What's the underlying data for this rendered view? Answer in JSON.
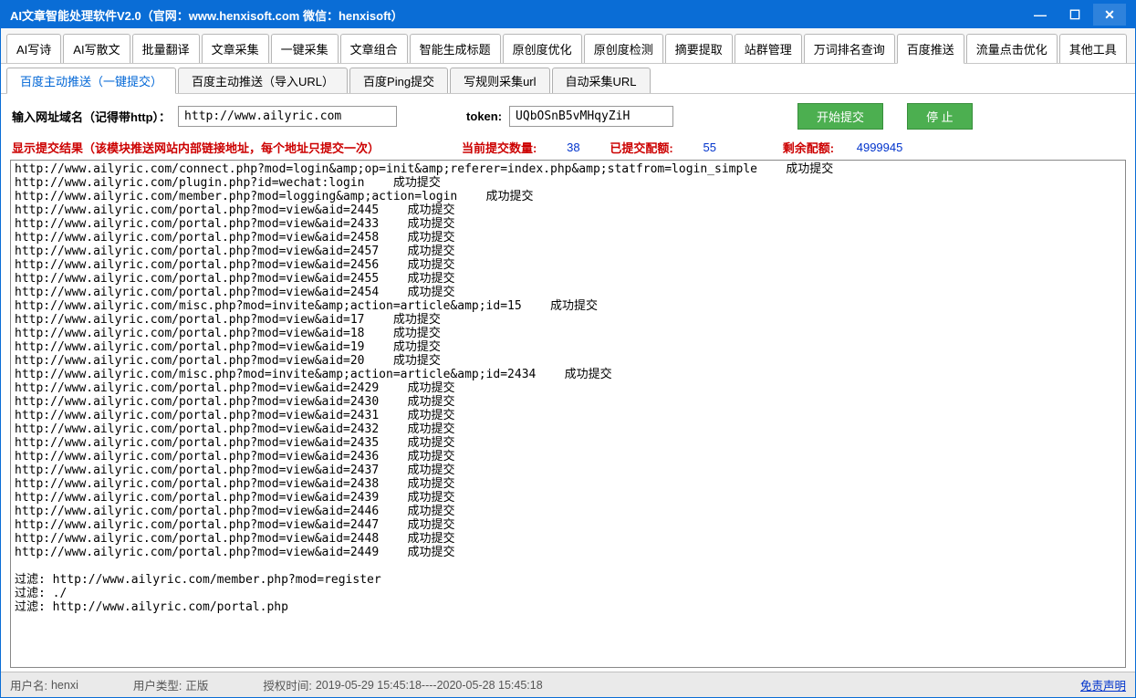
{
  "titlebar": "AI文章智能处理软件V2.0（官网：www.henxisoft.com  微信：henxisoft）",
  "main_tabs": [
    "AI写诗",
    "AI写散文",
    "批量翻译",
    "文章采集",
    "一键采集",
    "文章组合",
    "智能生成标题",
    "原创度优化",
    "原创度检测",
    "摘要提取",
    "站群管理",
    "万词排名查询",
    "百度推送",
    "流量点击优化",
    "其他工具"
  ],
  "main_tab_active": 12,
  "sub_tabs": [
    "百度主动推送（一键提交）",
    "百度主动推送（导入URL）",
    "百度Ping提交",
    "写规则采集url",
    "自动采集URL"
  ],
  "sub_tab_active": 0,
  "input": {
    "domain_label": "输入网址域名（记得带http）：",
    "domain_value": "http://www.ailyric.com",
    "token_label": "token:",
    "token_value": "UQbOSnB5vMHqyZiH",
    "start_btn": "开始提交",
    "stop_btn": "停 止"
  },
  "stats": {
    "result_label": "显示提交结果（该模块推送网站内部链接地址，每个地址只提交一次）",
    "current_label": "当前提交数量:",
    "current_value": "38",
    "submitted_label": "已提交配额:",
    "submitted_value": "55",
    "remain_label": "剩余配额:",
    "remain_value": "4999945"
  },
  "log_lines": [
    "http://www.ailyric.com/connect.php?mod=login&amp;op=init&amp;referer=index.php&amp;statfrom=login_simple    成功提交",
    "http://www.ailyric.com/plugin.php?id=wechat:login    成功提交",
    "http://www.ailyric.com/member.php?mod=logging&amp;action=login    成功提交",
    "http://www.ailyric.com/portal.php?mod=view&aid=2445    成功提交",
    "http://www.ailyric.com/portal.php?mod=view&aid=2433    成功提交",
    "http://www.ailyric.com/portal.php?mod=view&aid=2458    成功提交",
    "http://www.ailyric.com/portal.php?mod=view&aid=2457    成功提交",
    "http://www.ailyric.com/portal.php?mod=view&aid=2456    成功提交",
    "http://www.ailyric.com/portal.php?mod=view&aid=2455    成功提交",
    "http://www.ailyric.com/portal.php?mod=view&aid=2454    成功提交",
    "http://www.ailyric.com/misc.php?mod=invite&amp;action=article&amp;id=15    成功提交",
    "http://www.ailyric.com/portal.php?mod=view&aid=17    成功提交",
    "http://www.ailyric.com/portal.php?mod=view&aid=18    成功提交",
    "http://www.ailyric.com/portal.php?mod=view&aid=19    成功提交",
    "http://www.ailyric.com/portal.php?mod=view&aid=20    成功提交",
    "http://www.ailyric.com/misc.php?mod=invite&amp;action=article&amp;id=2434    成功提交",
    "http://www.ailyric.com/portal.php?mod=view&aid=2429    成功提交",
    "http://www.ailyric.com/portal.php?mod=view&aid=2430    成功提交",
    "http://www.ailyric.com/portal.php?mod=view&aid=2431    成功提交",
    "http://www.ailyric.com/portal.php?mod=view&aid=2432    成功提交",
    "http://www.ailyric.com/portal.php?mod=view&aid=2435    成功提交",
    "http://www.ailyric.com/portal.php?mod=view&aid=2436    成功提交",
    "http://www.ailyric.com/portal.php?mod=view&aid=2437    成功提交",
    "http://www.ailyric.com/portal.php?mod=view&aid=2438    成功提交",
    "http://www.ailyric.com/portal.php?mod=view&aid=2439    成功提交",
    "http://www.ailyric.com/portal.php?mod=view&aid=2446    成功提交",
    "http://www.ailyric.com/portal.php?mod=view&aid=2447    成功提交",
    "http://www.ailyric.com/portal.php?mod=view&aid=2448    成功提交",
    "http://www.ailyric.com/portal.php?mod=view&aid=2449    成功提交",
    "",
    "过滤: http://www.ailyric.com/member.php?mod=register",
    "过滤: ./",
    "过滤: http://www.ailyric.com/portal.php"
  ],
  "statusbar": {
    "user_label": "用户名:",
    "user_value": "henxi",
    "type_label": "用户类型:",
    "type_value": "正版",
    "auth_label": "授权时间:",
    "auth_value": "2019-05-29 15:45:18----2020-05-28 15:45:18",
    "disclaimer": "免责声明"
  }
}
